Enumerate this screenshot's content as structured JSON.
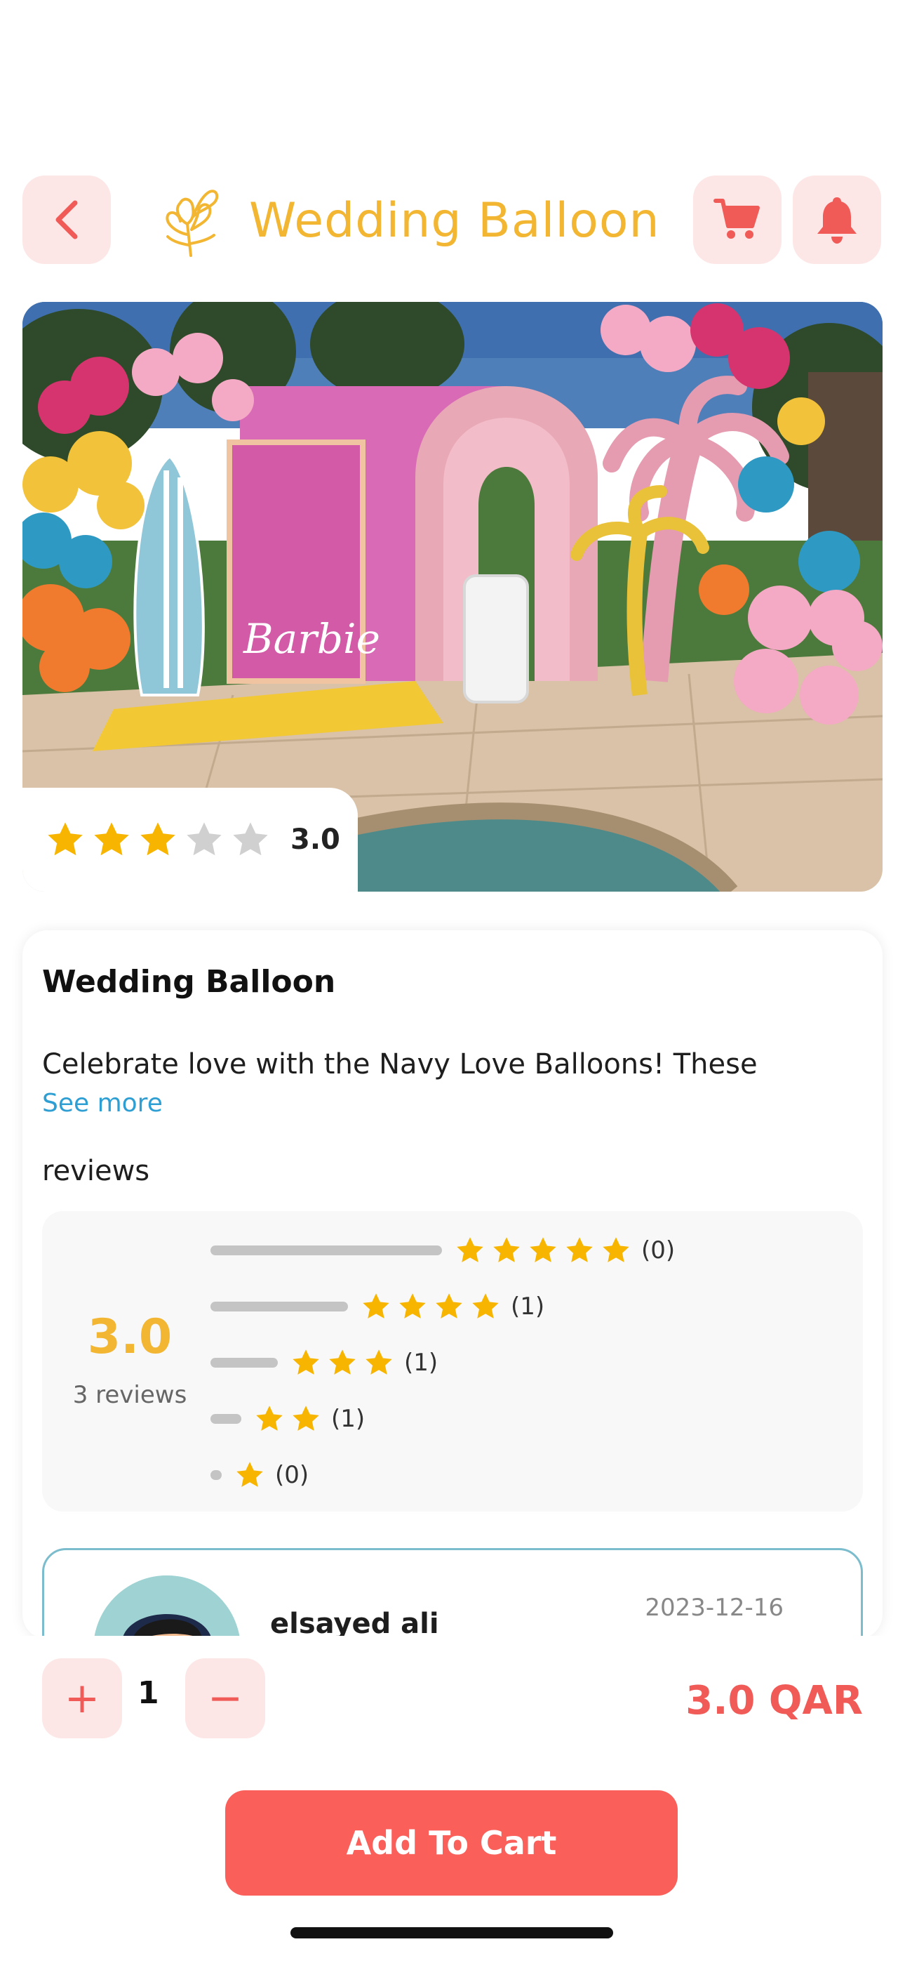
{
  "header": {
    "title": "Wedding Balloon",
    "back_icon": "chevron-left-icon",
    "logo_icon": "flower-bouquet-icon",
    "cart_icon": "cart-icon",
    "bell_icon": "bell-icon"
  },
  "hero": {
    "rating": "3.0",
    "stars_filled": 3,
    "stars_total": 5,
    "image_text": "Barbie"
  },
  "product": {
    "title": "Wedding Balloon",
    "description": "Celebrate love with the Navy Love Balloons! These",
    "see_more": "See more"
  },
  "reviews": {
    "label": "reviews",
    "average": "3.0",
    "count_label": "3 reviews",
    "distribution": [
      {
        "stars": 5,
        "count": "(0)"
      },
      {
        "stars": 4,
        "count": "(1)"
      },
      {
        "stars": 3,
        "count": "(1)"
      },
      {
        "stars": 2,
        "count": "(1)"
      },
      {
        "stars": 1,
        "count": "(0)"
      }
    ],
    "items": [
      {
        "name": "elsayed ali",
        "date": "2023-12-16"
      }
    ]
  },
  "cart": {
    "plus": "+",
    "minus": "−",
    "quantity": "1",
    "price": "3.0 QAR",
    "add_button": "Add To Cart"
  },
  "colors": {
    "accent": "#f05a57",
    "brand_gold": "#f2b632",
    "star": "#f7b500",
    "button_bg": "#fa5f5a",
    "chip_bg": "#fde7e6"
  }
}
